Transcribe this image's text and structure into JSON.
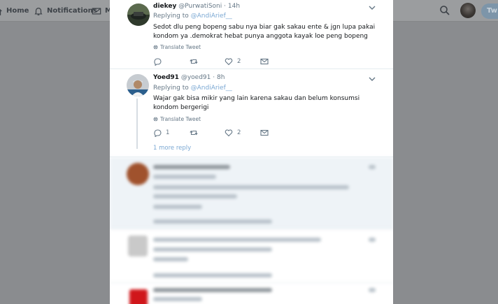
{
  "nav": {
    "home_label": "Home",
    "notifications_label": "Notifications",
    "messages_label": "M",
    "tweet_button_label": "Tw"
  },
  "tweets": [
    {
      "name": "diekey",
      "handle": "@PurwatiSoni",
      "time": "14h",
      "replying_prefix": "Replying to",
      "replying_to": "@AndiArief__",
      "text": "Sedot dlu peng bopeng sabu nya biar gak sakau ente & jgn lupa pakai kondom ya .demokrat hebat punya anggota kayak loe peng bopeng",
      "translate_label": "Translate Tweet",
      "reply_count": "",
      "retweet_count": "",
      "like_count": "2"
    },
    {
      "name": "Yoed91",
      "handle": "@yoed91",
      "time": "8h",
      "replying_prefix": "Replying to",
      "replying_to": "@AndiArief__",
      "text": "Wajar gak bisa mikir yang lain karena sakau dan belum konsumsi kondom bergerigi",
      "translate_label": "Translate Tweet",
      "reply_count": "1",
      "retweet_count": "",
      "like_count": "2",
      "more_replies_label": "1 more reply"
    }
  ],
  "colors": {
    "accent": "#1da1f2",
    "text": "#14171a",
    "muted": "#657786",
    "overlay": "#8a8c8f"
  }
}
